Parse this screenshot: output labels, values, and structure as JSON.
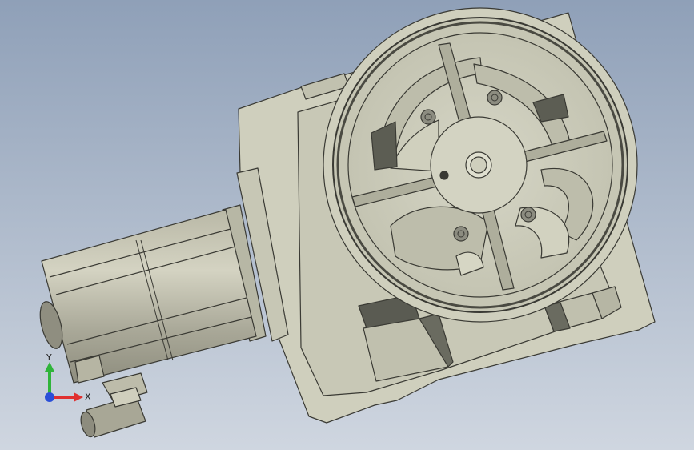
{
  "viewport": {
    "background_top": "#8fa0b8",
    "background_bottom": "#cfd6e0"
  },
  "model": {
    "part_color": "#cfcfbd",
    "edge_color": "#3a3a34",
    "shadow_color": "#5a5b52"
  },
  "triad": {
    "y_label": "Y",
    "x_label": "X",
    "y_color": "#2fb43a",
    "x_color": "#e03030",
    "z_color": "#2a4fd8"
  }
}
